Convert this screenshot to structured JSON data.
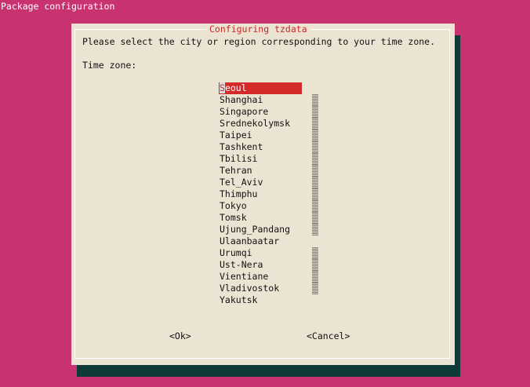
{
  "screen_title": "Package configuration",
  "dialog": {
    "title": "Configuring tzdata",
    "prompt": "Please select the city or region corresponding to your time zone.",
    "list_label": "Time zone:",
    "items": [
      "Seoul",
      "Shanghai",
      "Singapore",
      "Srednekolymsk",
      "Taipei",
      "Tashkent",
      "Tbilisi",
      "Tehran",
      "Tel_Aviv",
      "Thimphu",
      "Tokyo",
      "Tomsk",
      "Ujung_Pandang",
      "Ulaanbaatar",
      "Urumqi",
      "Ust-Nera",
      "Vientiane",
      "Vladivostok",
      "Yakutsk"
    ],
    "selected": "Seoul",
    "ok_label": "<Ok>",
    "cancel_label": "<Cancel>"
  },
  "colors": {
    "background": "#c83270",
    "dialog": "#ece4d3",
    "shadow": "#0f3a3a",
    "highlight": "#d42a2a",
    "title_text": "#c82828"
  }
}
